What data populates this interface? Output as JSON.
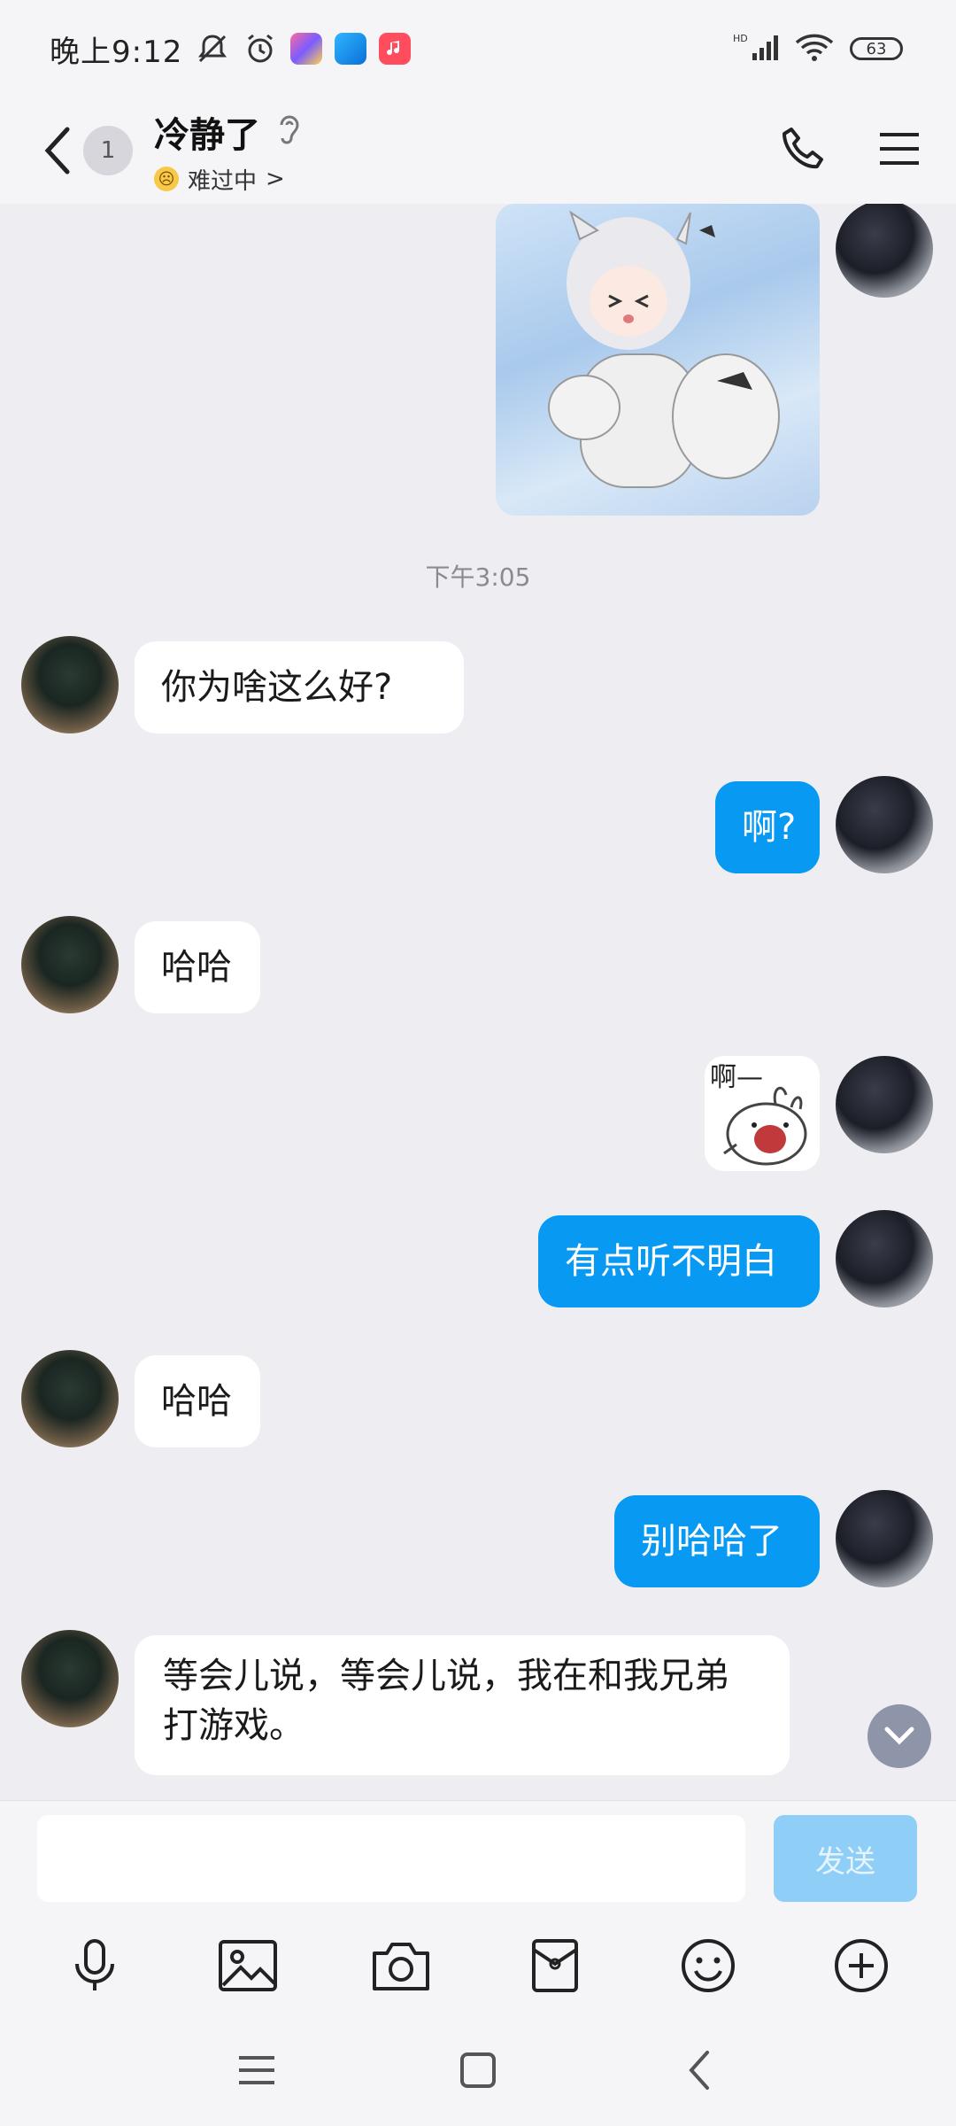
{
  "status_bar": {
    "time": "晚上9:12",
    "battery": "63",
    "network_label": "HD"
  },
  "header": {
    "unread_count": "1",
    "contact_name": "冷静了",
    "status_text": "难过中",
    "status_chevron": ">"
  },
  "messages": {
    "timestamp": "下午3:05",
    "m1": "你为啥这么好?",
    "m2": "啊?",
    "m3": "哈哈",
    "sticker_text": "啊—",
    "m4": "有点听不明白",
    "m5": "哈哈",
    "m6": "别哈哈了",
    "m7": "等会儿说，等会儿说，我在和我兄弟打游戏。"
  },
  "input": {
    "placeholder": "",
    "send_label": "发送"
  },
  "colors": {
    "outgoing_bubble": "#0899f2",
    "incoming_bubble": "#ffffff",
    "send_button_disabled": "#8fcff7",
    "background": "#ededf2"
  },
  "icons": {
    "toolbar": [
      "microphone-icon",
      "image-icon",
      "camera-icon",
      "red-packet-icon",
      "emoji-icon",
      "plus-icon"
    ],
    "header": [
      "phone-icon",
      "menu-icon"
    ],
    "nav": [
      "recents-icon",
      "home-icon",
      "back-icon"
    ]
  }
}
